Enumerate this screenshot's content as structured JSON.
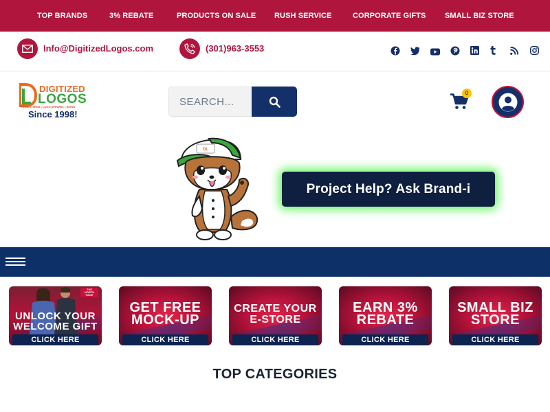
{
  "top_nav": {
    "items": [
      "TOP BRANDS",
      "3% REBATE",
      "PRODUCTS ON SALE",
      "RUSH SERVICE",
      "CORPORATE GIFTS",
      "SMALL BIZ STORE"
    ],
    "background": "#b0163d"
  },
  "contact": {
    "email": "Info@DigitizedLogos.com",
    "phone": "(301)963-3553"
  },
  "social": [
    "facebook-icon",
    "twitter-icon",
    "youtube-icon",
    "pinterest-icon",
    "linkedin-icon",
    "tumblr-icon",
    "rss-icon",
    "instagram-icon"
  ],
  "logo": {
    "brand_top": "DIGITIZED",
    "brand_bottom": "LOGOS",
    "tagline": "PROMO ITEMS | LOGO APPAREL | SIGNS",
    "since": "Since 1998!"
  },
  "search": {
    "placeholder": "SEARCH..."
  },
  "cart": {
    "count": "0"
  },
  "help": {
    "label": "Project Help? Ask Brand-i"
  },
  "promos": [
    {
      "lines": [
        "UNLOCK YOUR",
        "WELCOME GIFT"
      ],
      "cta": "CLICK HERE",
      "badge": "THE NORTH FACE"
    },
    {
      "lines": [
        "GET FREE",
        "MOCK-UP"
      ],
      "cta": "CLICK HERE"
    },
    {
      "lines": [
        "CREATE YOUR",
        "E-STORE"
      ],
      "cta": "CLICK HERE"
    },
    {
      "lines": [
        "EARN 3%",
        "REBATE"
      ],
      "cta": "CLICK HERE"
    },
    {
      "lines": [
        "SMALL BIZ",
        "STORE"
      ],
      "cta": "CLICK HERE"
    }
  ],
  "section_title": "TOP CATEGORIES",
  "colors": {
    "brand_red": "#b0163d",
    "navy": "#0d3068",
    "glow": "#61f55d"
  }
}
